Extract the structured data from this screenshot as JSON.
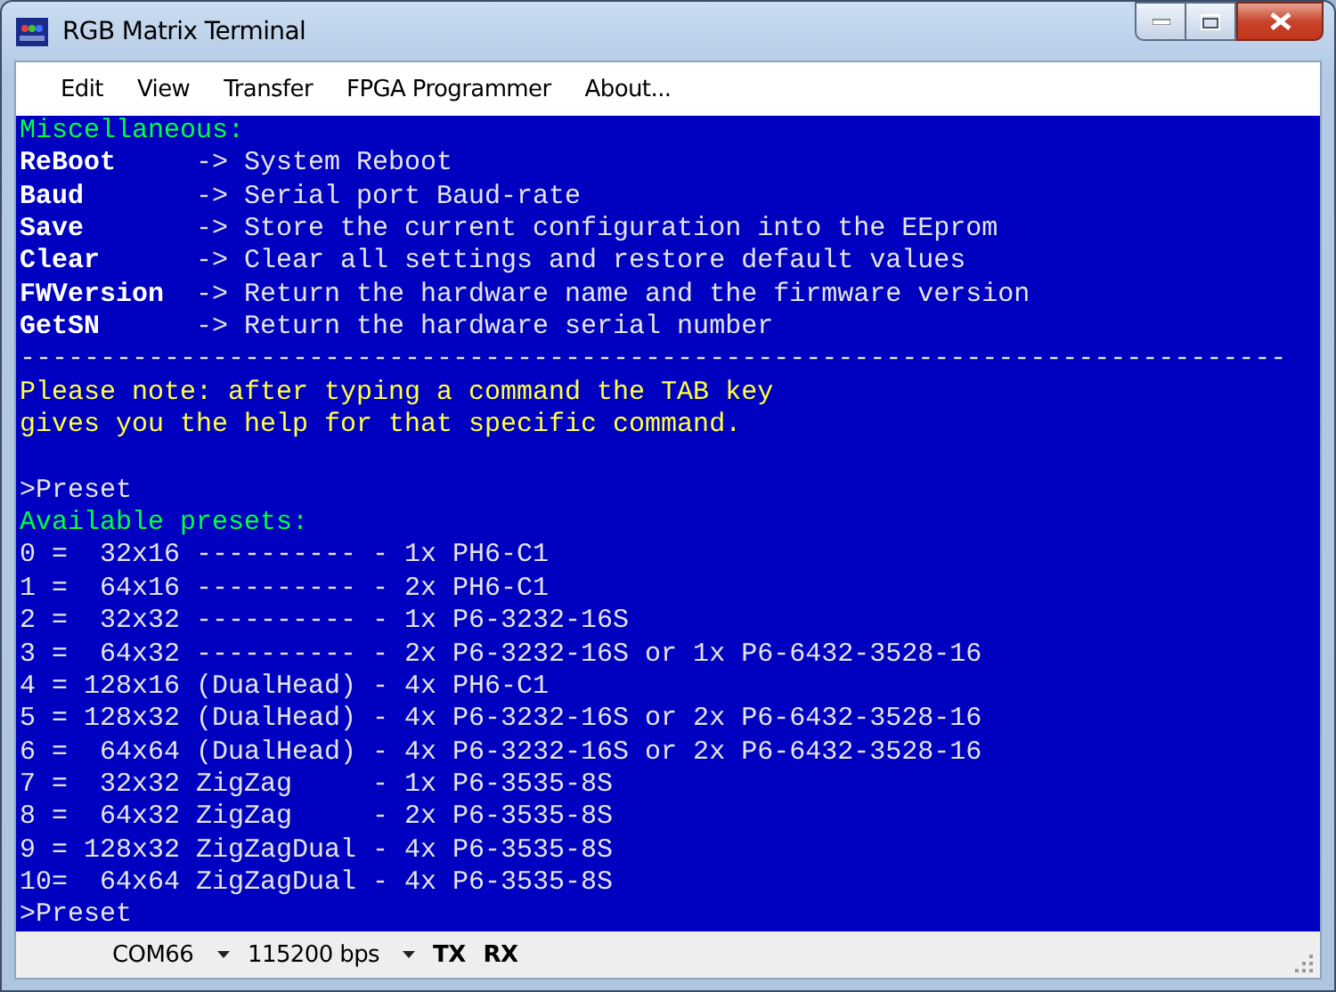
{
  "window": {
    "title": "RGB Matrix Terminal"
  },
  "menu": [
    "Edit",
    "View",
    "Transfer",
    "FPGA Programmer",
    "About..."
  ],
  "terminal": {
    "lines": [
      {
        "kind": "heading",
        "text": "Miscellaneous:"
      },
      {
        "kind": "command",
        "name": "ReBoot",
        "text": "-> System Reboot"
      },
      {
        "kind": "command",
        "name": "Baud",
        "text": "-> Serial port Baud-rate"
      },
      {
        "kind": "command",
        "name": "Save",
        "text": "-> Store the current configuration into the EEprom"
      },
      {
        "kind": "command",
        "name": "Clear",
        "text": "-> Clear all settings and restore default values"
      },
      {
        "kind": "command",
        "name": "FWVersion",
        "text": "-> Return the hardware name and the firmware version"
      },
      {
        "kind": "command",
        "name": "GetSN",
        "text": "-> Return the hardware serial number"
      },
      {
        "kind": "output",
        "text": "-------------------------------------------------------------------------------"
      },
      {
        "kind": "note",
        "text": "Please note: after typing a command the TAB key"
      },
      {
        "kind": "note",
        "text": "gives you the help for that specific command."
      },
      {
        "kind": "blank"
      },
      {
        "kind": "output",
        "text": ">Preset"
      },
      {
        "kind": "heading",
        "text": "Available presets:"
      },
      {
        "kind": "output",
        "text": "0 =  32x16 ---------- - 1x PH6-C1"
      },
      {
        "kind": "output",
        "text": "1 =  64x16 ---------- - 2x PH6-C1"
      },
      {
        "kind": "output",
        "text": "2 =  32x32 ---------- - 1x P6-3232-16S"
      },
      {
        "kind": "output",
        "text": "3 =  64x32 ---------- - 2x P6-3232-16S or 1x P6-6432-3528-16"
      },
      {
        "kind": "output",
        "text": "4 = 128x16 (DualHead) - 4x PH6-C1"
      },
      {
        "kind": "output",
        "text": "5 = 128x32 (DualHead) - 4x P6-3232-16S or 2x P6-6432-3528-16"
      },
      {
        "kind": "output",
        "text": "6 =  64x64 (DualHead) - 4x P6-3232-16S or 2x P6-6432-3528-16"
      },
      {
        "kind": "output",
        "text": "7 =  32x32 ZigZag     - 1x P6-3535-8S"
      },
      {
        "kind": "output",
        "text": "8 =  64x32 ZigZag     - 2x P6-3535-8S"
      },
      {
        "kind": "output",
        "text": "9 = 128x32 ZigZagDual - 4x P6-3535-8S"
      },
      {
        "kind": "output",
        "text": "10=  64x64 ZigZagDual - 4x P6-3535-8S"
      },
      {
        "kind": "output",
        "text": ">Preset"
      }
    ]
  },
  "status_bar": {
    "port": "COM66",
    "baud": "115200 bps",
    "indicators": [
      "TX",
      "RX"
    ]
  }
}
